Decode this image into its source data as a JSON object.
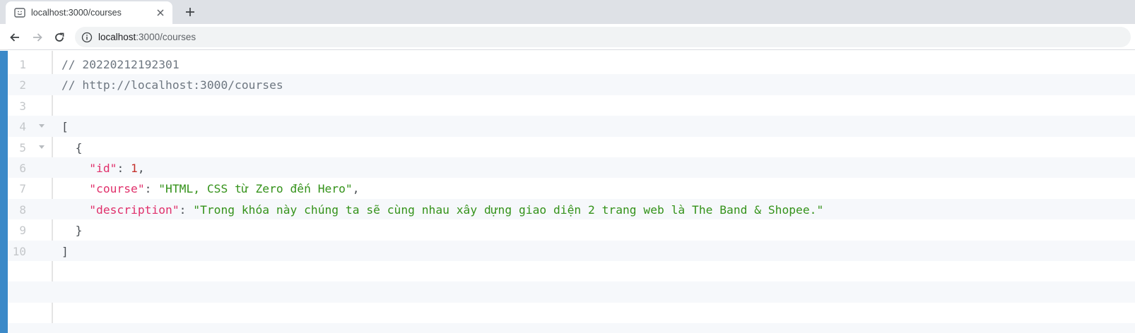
{
  "tab": {
    "title": "localhost:3000/courses"
  },
  "address": {
    "host": "localhost",
    "path": ":3000/courses"
  },
  "lines": [
    {
      "num": "1",
      "comment": "// 20220212192301"
    },
    {
      "num": "2",
      "comment": "// http://localhost:3000/courses"
    },
    {
      "num": "3"
    },
    {
      "num": "4",
      "open_bracket": "["
    },
    {
      "num": "5",
      "open_brace": "{"
    },
    {
      "num": "6",
      "key": "\"id\"",
      "colon": ": ",
      "value": "1",
      "comma": ","
    },
    {
      "num": "7",
      "key": "\"course\"",
      "colon": ": ",
      "value": "\"HTML, CSS từ Zero đến Hero\"",
      "comma": ","
    },
    {
      "num": "8",
      "key": "\"description\"",
      "colon": ": ",
      "value": "\"Trong khóa này chúng ta sẽ cùng nhau xây dựng giao diện 2 trang web là The Band & Shopee.\""
    },
    {
      "num": "9",
      "close_brace": "}"
    },
    {
      "num": "10",
      "close_bracket": "]"
    }
  ],
  "colors": {
    "left_bar": "#3b89c8",
    "key": "#e0306b",
    "string": "#34921a",
    "number": "#c4302b",
    "comment": "#6e7781"
  },
  "icons": {
    "favicon": "page-favicon-icon",
    "tab_close": "close-icon",
    "new_tab": "plus-icon",
    "back": "arrow-left-icon",
    "forward": "arrow-right-icon",
    "reload": "reload-icon",
    "site_info": "info-icon",
    "fold": "fold-triangle-icon"
  }
}
